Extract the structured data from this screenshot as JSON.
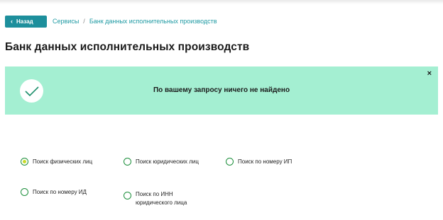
{
  "nav": {
    "back_label": "Назад",
    "breadcrumb": [
      "Сервисы",
      "Банк данных исполнительных производств"
    ],
    "separator": "/"
  },
  "page": {
    "title": "Банк данных исполнительных производств"
  },
  "alert": {
    "message": "По вашему запросу ничего не найдено",
    "close_glyph": "×",
    "background_color": "#a4efd2"
  },
  "search_options": [
    {
      "label": "Поиск физических лиц",
      "selected": true
    },
    {
      "label": "Поиск юридических лиц",
      "selected": false
    },
    {
      "label": "Поиск по номеру ИП",
      "selected": false
    },
    {
      "label": "Поиск по номеру ИД",
      "selected": false
    },
    {
      "label_line1": "Поиск по ИНН",
      "label_line2": "юридического лица",
      "selected": false
    }
  ],
  "colors": {
    "accent": "#1d8f9c",
    "radio_border": "#1d8f3c",
    "radio_selected": "#c7da2b"
  }
}
